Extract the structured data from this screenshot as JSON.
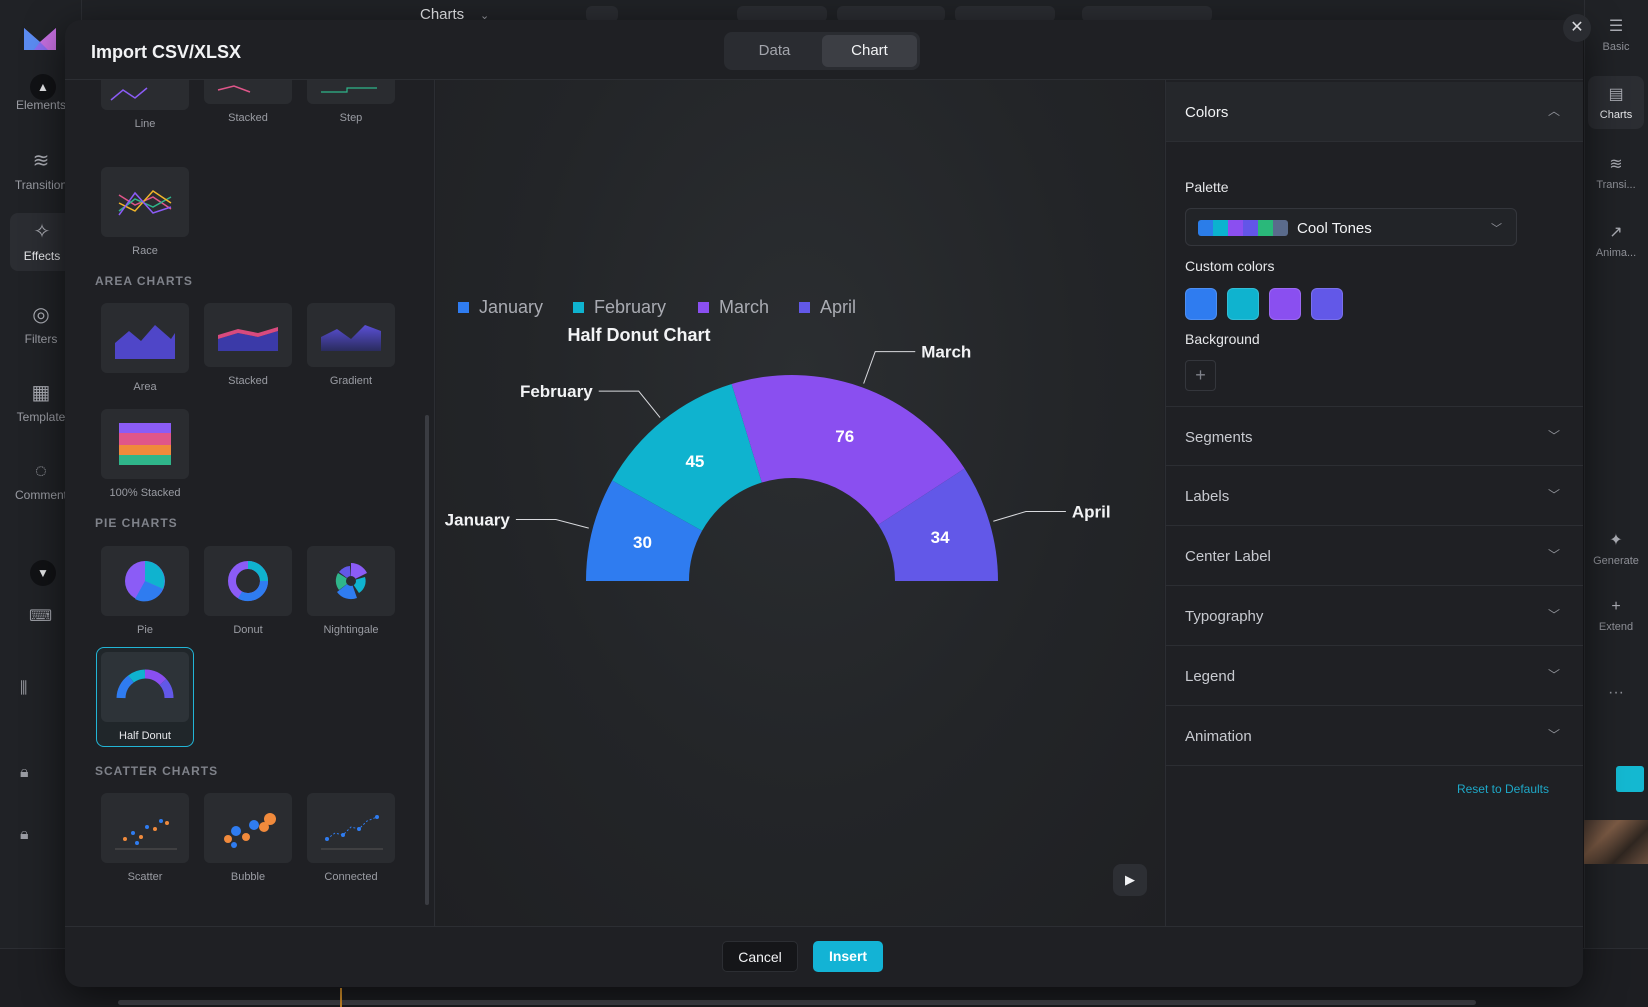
{
  "app": {
    "top_title": "Charts",
    "left_tools": [
      "Elements",
      "Transition",
      "Effects",
      "Filters",
      "Template",
      "Comment"
    ],
    "right_tools": [
      "Basic",
      "Charts",
      "Transi...",
      "Anima...",
      "Generate",
      "Extend"
    ]
  },
  "modal": {
    "title": "Import CSV/XLSX",
    "tabs": [
      "Data",
      "Chart"
    ],
    "active_tab": "Chart",
    "cancel_label": "Cancel",
    "insert_label": "Insert"
  },
  "chart_types": {
    "top_row": [
      "Line",
      "Stacked",
      "Step"
    ],
    "race": "Race",
    "area_title": "AREA CHARTS",
    "area": [
      "Area",
      "Stacked",
      "Gradient",
      "100% Stacked"
    ],
    "pie_title": "PIE CHARTS",
    "pie": [
      "Pie",
      "Donut",
      "Nightingale",
      "Half Donut"
    ],
    "selected": "Half Donut",
    "scatter_title": "SCATTER CHARTS",
    "scatter": [
      "Scatter",
      "Bubble",
      "Connected"
    ]
  },
  "settings": {
    "colors_label": "Colors",
    "palette_label": "Palette",
    "palette_name": "Cool Tones",
    "palette_colors": [
      "#2b7de9",
      "#0bb3cf",
      "#8b4ff0",
      "#6355e8",
      "#2ab87a",
      "#5a6b8c"
    ],
    "custom_colors_label": "Custom colors",
    "custom_colors": [
      "#2f7cf0",
      "#0fb3cf",
      "#8a4ff0",
      "#6258e8"
    ],
    "background_label": "Background",
    "sections": [
      "Segments",
      "Labels",
      "Center Label",
      "Typography",
      "Legend",
      "Animation"
    ],
    "reset_label": "Reset to Defaults"
  },
  "chart_data": {
    "type": "pie",
    "variant": "half-donut",
    "title": "Half Donut Chart",
    "categories": [
      "January",
      "February",
      "March",
      "April"
    ],
    "values": [
      30,
      45,
      76,
      34
    ],
    "colors": [
      "#2f7cf0",
      "#0fb3cf",
      "#8a4ff0",
      "#6258e8"
    ],
    "legend": "top-left"
  }
}
